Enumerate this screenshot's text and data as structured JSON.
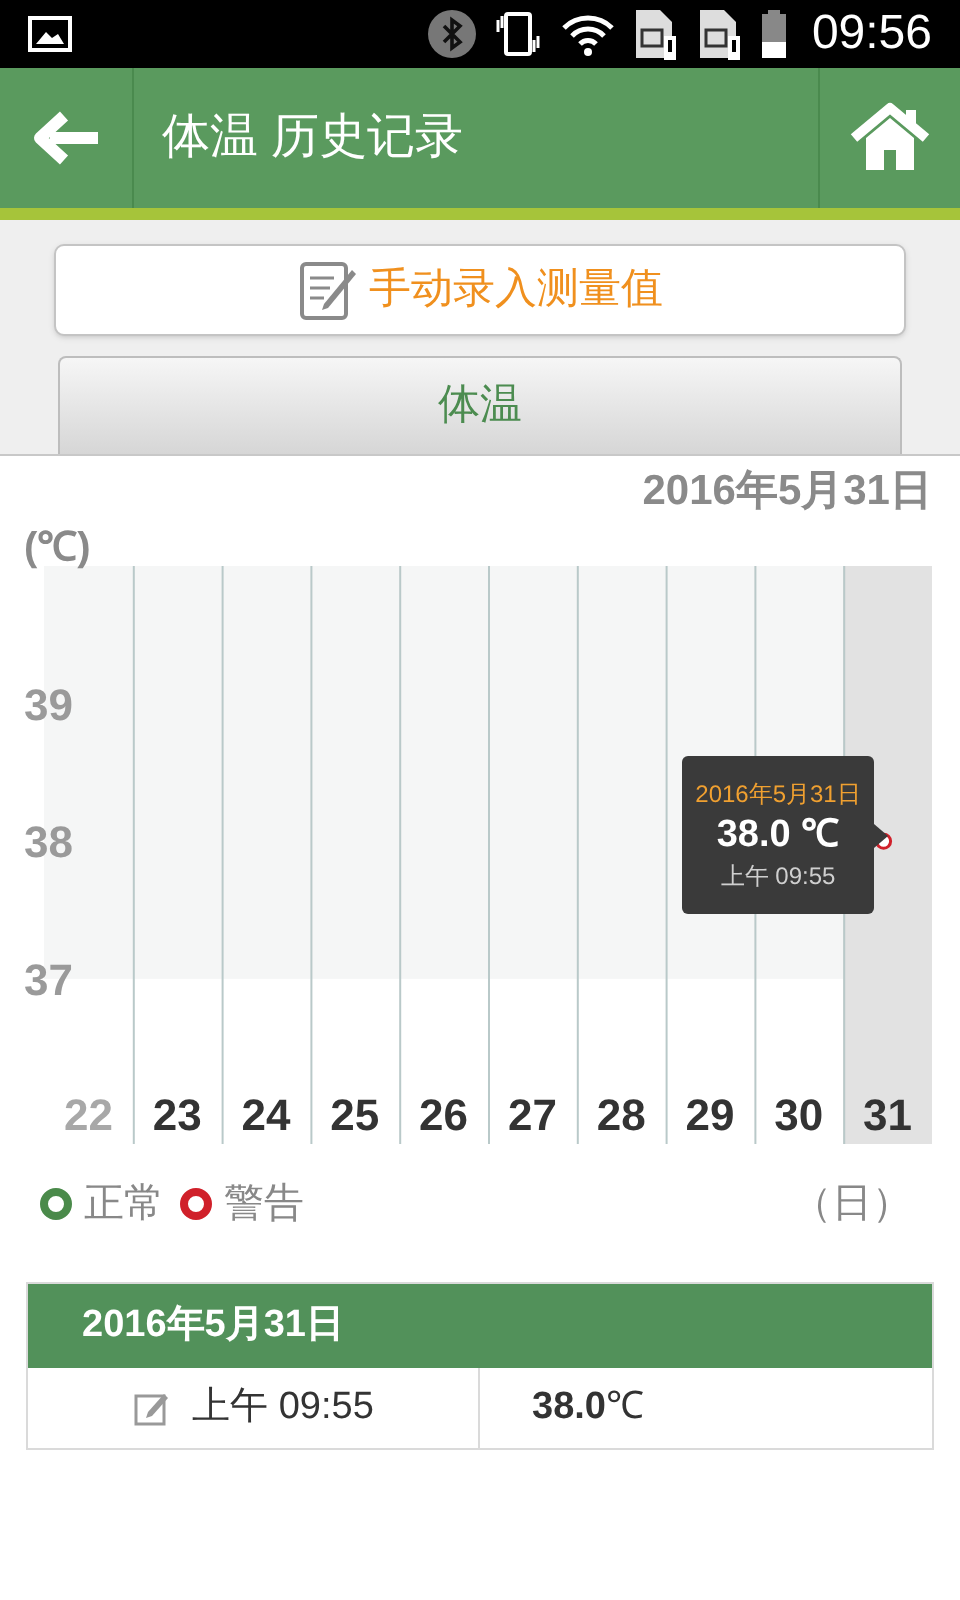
{
  "status_bar": {
    "time": "09:56"
  },
  "header": {
    "title": "体温 历史记录"
  },
  "manual_entry_button": {
    "label": "手动录入测量值"
  },
  "category_button": {
    "label": "体温"
  },
  "chart": {
    "date": "2016年5月31日",
    "day_columns": [
      {
        "dimmed": true
      },
      {
        "dimmed": false
      },
      {
        "dimmed": false
      },
      {
        "dimmed": false
      },
      {
        "dimmed": false
      },
      {
        "dimmed": false
      },
      {
        "dimmed": false
      },
      {
        "dimmed": false
      },
      {
        "dimmed": false
      },
      {
        "dimmed": false
      }
    ],
    "tooltip": {
      "date": "2016年5月31日",
      "value": "38.0 ℃",
      "time": "上午 09:55"
    },
    "chart_data": {
      "type": "line",
      "ylabel": "(℃)",
      "xlabel": "（日）",
      "categories": [
        "22",
        "23",
        "24",
        "25",
        "26",
        "27",
        "28",
        "29",
        "30",
        "31"
      ],
      "series": [
        {
          "color": "#d0202a",
          "marker": "circle",
          "values": [
            null,
            null,
            null,
            null,
            null,
            null,
            null,
            null,
            null,
            38.0
          ]
        }
      ],
      "ylim": [
        35.8,
        40
      ],
      "yticks": [
        37,
        38,
        39
      ],
      "bands": [
        {
          "axis": "y",
          "from": 37,
          "to": 40,
          "color": "#f5f6f6"
        },
        {
          "axis": "x",
          "from": "31",
          "to": "31",
          "color": "#e2e2e2"
        }
      ]
    }
  },
  "legend": [
    {
      "label": "正常",
      "color": "#4a8a4a"
    },
    {
      "label": "警告",
      "color": "#d0202a"
    }
  ],
  "records": {
    "date": "2016年5月31日",
    "entries": [
      {
        "kind": "manual",
        "time": "上午 09:55",
        "value": "**38.0**℃"
      }
    ]
  }
}
